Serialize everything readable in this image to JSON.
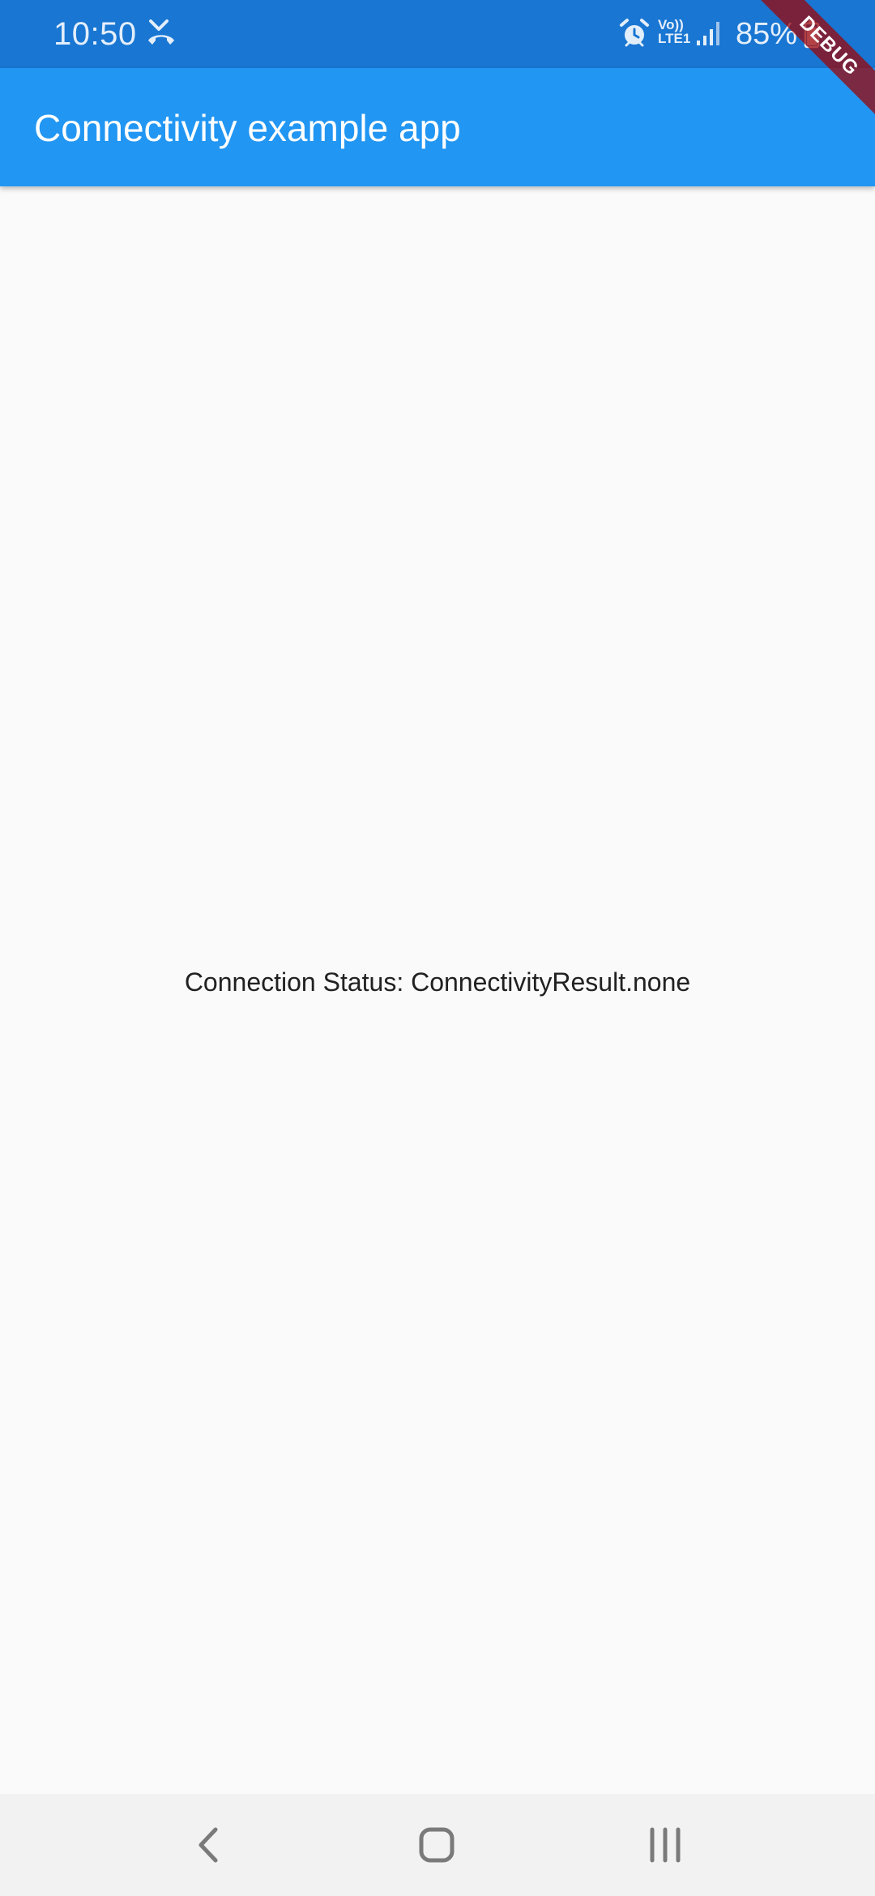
{
  "status_bar": {
    "time": "10:50",
    "network_label_top": "Vo))",
    "network_label_bottom": "LTE1",
    "battery_percent": "85%",
    "icons": [
      "missed-call-icon",
      "alarm-icon",
      "signal-icon",
      "battery-icon"
    ],
    "background_color": "#1976D2"
  },
  "app_bar": {
    "title": "Connectivity example app",
    "background_color": "#2196F3"
  },
  "debug_banner": {
    "label": "DEBUG"
  },
  "body": {
    "connection_status": "Connection Status: ConnectivityResult.none"
  },
  "nav_bar": {
    "icons": [
      "back-icon",
      "home-icon",
      "recents-icon"
    ]
  }
}
